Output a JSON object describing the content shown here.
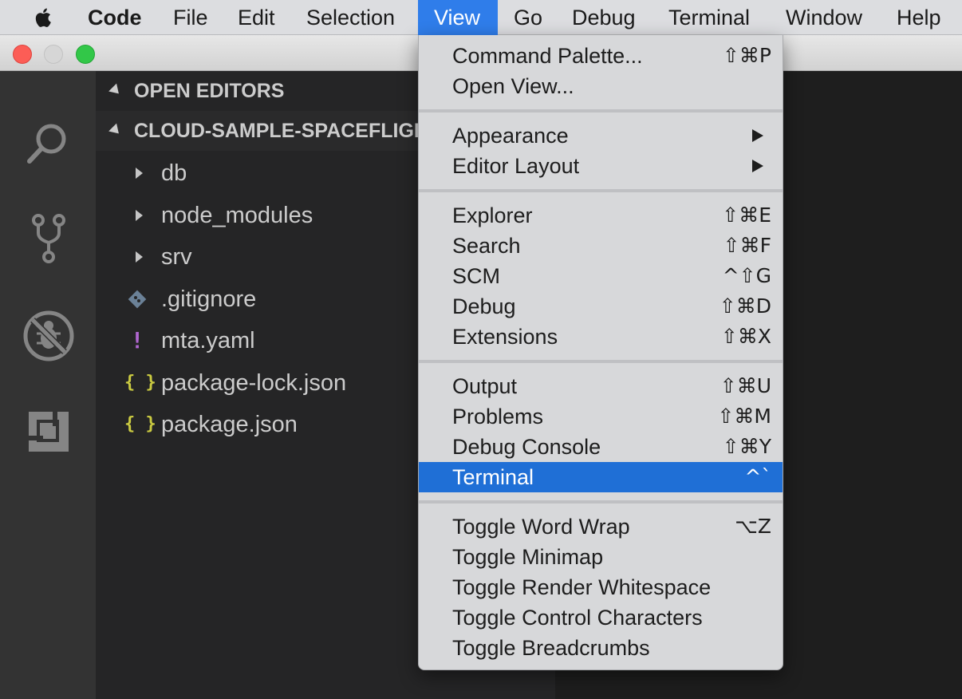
{
  "menubar": {
    "apple_icon": "apple-logo",
    "items": [
      "Code",
      "File",
      "Edit",
      "Selection",
      "View",
      "Go",
      "Debug",
      "Terminal",
      "Window",
      "Help"
    ],
    "active": "View"
  },
  "activity_bar": {
    "icons": [
      "search-icon",
      "source-control-icon",
      "debug-icon",
      "extensions-icon"
    ]
  },
  "explorer": {
    "open_editors": "OPEN EDITORS",
    "project": "CLOUD-SAMPLE-SPACEFLIGHT",
    "items": [
      {
        "name": "db",
        "type": "folder"
      },
      {
        "name": "node_modules",
        "type": "folder"
      },
      {
        "name": "srv",
        "type": "folder"
      },
      {
        "name": ".gitignore",
        "type": "git",
        "icon": "git-diamond-icon",
        "color": "#6b8197"
      },
      {
        "name": "mta.yaml",
        "type": "yaml",
        "icon_glyph": "!",
        "color": "#b167d1"
      },
      {
        "name": "package-lock.json",
        "type": "json",
        "icon_glyph": "{ }",
        "color": "#cbcb41"
      },
      {
        "name": "package.json",
        "type": "json",
        "icon_glyph": "{ }",
        "color": "#cbcb41"
      }
    ]
  },
  "view_menu": {
    "groups": [
      [
        {
          "label": "Command Palette...",
          "shortcut": "⇧⌘P"
        },
        {
          "label": "Open View...",
          "shortcut": ""
        }
      ],
      [
        {
          "label": "Appearance",
          "submenu": true
        },
        {
          "label": "Editor Layout",
          "submenu": true
        }
      ],
      [
        {
          "label": "Explorer",
          "shortcut": "⇧⌘E"
        },
        {
          "label": "Search",
          "shortcut": "⇧⌘F"
        },
        {
          "label": "SCM",
          "shortcut": "^⇧G"
        },
        {
          "label": "Debug",
          "shortcut": "⇧⌘D"
        },
        {
          "label": "Extensions",
          "shortcut": "⇧⌘X"
        }
      ],
      [
        {
          "label": "Output",
          "shortcut": "⇧⌘U"
        },
        {
          "label": "Problems",
          "shortcut": "⇧⌘M"
        },
        {
          "label": "Debug Console",
          "shortcut": "⇧⌘Y"
        },
        {
          "label": "Terminal",
          "shortcut": "^`",
          "highlighted": true
        }
      ],
      [
        {
          "label": "Toggle Word Wrap",
          "shortcut": "⌥Z"
        },
        {
          "label": "Toggle Minimap",
          "shortcut": ""
        },
        {
          "label": "Toggle Render Whitespace",
          "shortcut": ""
        },
        {
          "label": "Toggle Control Characters",
          "shortcut": ""
        },
        {
          "label": "Toggle Breadcrumbs",
          "shortcut": ""
        }
      ]
    ]
  },
  "colors": {
    "menu_highlight": "#1f6fd6",
    "menubar_active": "#2f7dea",
    "sidebar_bg": "#252526",
    "activitybar_bg": "#333333"
  }
}
